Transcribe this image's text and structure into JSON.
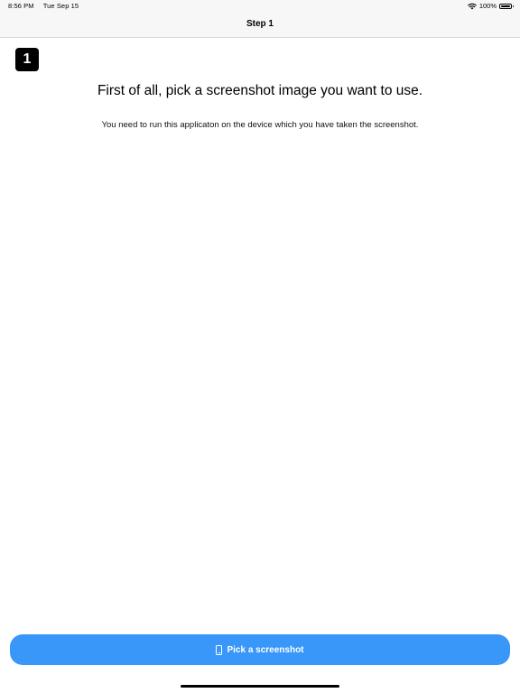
{
  "status_bar": {
    "time": "8:56 PM",
    "date": "Tue Sep 15",
    "battery": "100%"
  },
  "nav": {
    "title": "Step 1"
  },
  "step": {
    "number": "1"
  },
  "content": {
    "headline": "First of all, pick a screenshot image you want to use.",
    "subtext": "You need to run this applicaton on the device which you have taken the screenshot."
  },
  "actions": {
    "pick_label": "Pick a screenshot",
    "pick_icon": "phone-icon",
    "accent_color": "#3897f9"
  }
}
